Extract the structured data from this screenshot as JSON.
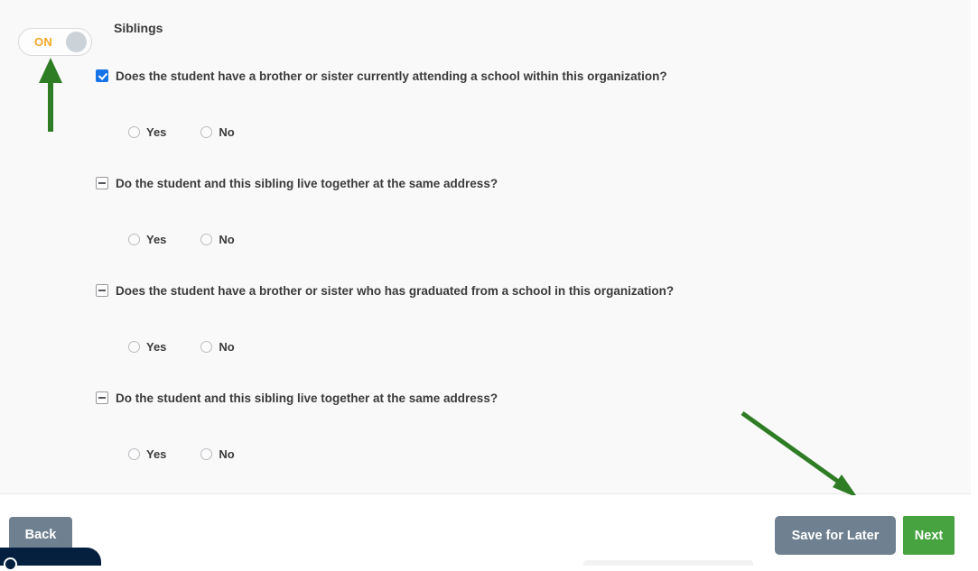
{
  "toggle": {
    "label": "ON",
    "state": "on",
    "accent_color": "#f5a623",
    "knob_color": "#ccd3d8"
  },
  "annotations": {
    "color": "#2e7d24",
    "arrow_up_name": "annotation-arrow-up",
    "arrow_diagonal_name": "annotation-arrow-diagonal"
  },
  "section": {
    "title": "Siblings"
  },
  "questions": [
    {
      "checkbox_state": "checked",
      "text": "Does the student have a brother or sister currently attending a school within this organization?",
      "options": [
        "Yes",
        "No"
      ],
      "selected": null
    },
    {
      "checkbox_state": "indeterminate",
      "text": "Do the student and this sibling live together at the same address?",
      "options": [
        "Yes",
        "No"
      ],
      "selected": null
    },
    {
      "checkbox_state": "indeterminate",
      "text": "Does the student have a brother or sister who has graduated from a school in this organization?",
      "options": [
        "Yes",
        "No"
      ],
      "selected": null
    },
    {
      "checkbox_state": "indeterminate",
      "text": "Do the student and this sibling live together at the same address?",
      "options": [
        "Yes",
        "No"
      ],
      "selected": null
    }
  ],
  "footer": {
    "back_label": "Back",
    "save_label": "Save for Later",
    "next_label": "Next",
    "back_color": "#6f8190",
    "save_color": "#6f8190",
    "next_color": "#46a340"
  },
  "chat_widget": {
    "icon": "chat-bubble-icon",
    "color": "#05203f"
  }
}
